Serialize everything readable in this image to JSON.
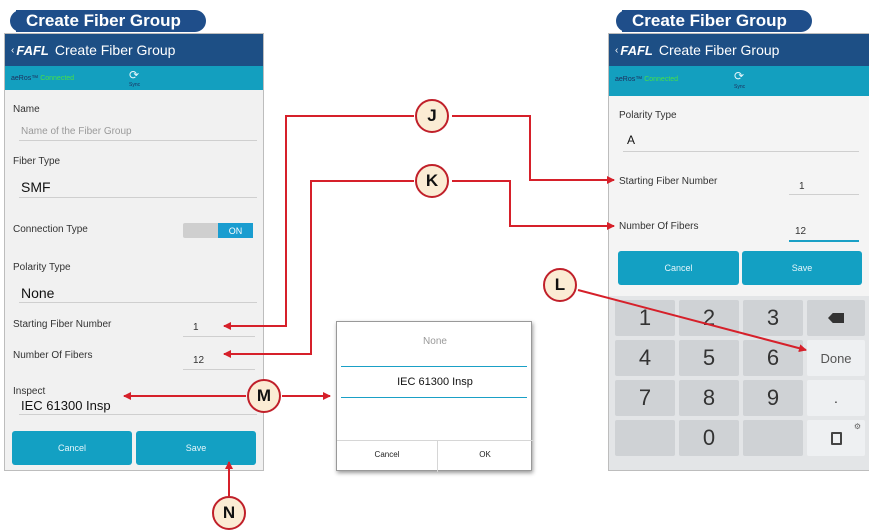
{
  "left_title": "Create Fiber Group",
  "right_title": "Create Fiber Group",
  "app": {
    "logo": "FAFL",
    "title": "Create Fiber Group",
    "aeros": "aeRos™",
    "connected": "Connected",
    "sync": "Sync"
  },
  "left_form": {
    "name_label": "Name",
    "name_placeholder": "Name of the Fiber Group",
    "fiber_type_label": "Fiber Type",
    "fiber_type_value": "SMF",
    "connection_type_label": "Connection Type",
    "toggle_on": "ON",
    "polarity_label": "Polarity Type",
    "polarity_value": "None",
    "starting_fiber_label": "Starting Fiber Number",
    "starting_fiber_value": "1",
    "num_fibers_label": "Number Of Fibers",
    "num_fibers_value": "12",
    "inspect_label": "Inspect",
    "inspect_value": "IEC 61300 Insp",
    "cancel": "Cancel",
    "save": "Save"
  },
  "dialog": {
    "option_none": "None",
    "option_selected": "IEC 61300 Insp",
    "cancel": "Cancel",
    "ok": "OK"
  },
  "right_form": {
    "polarity_label": "Polarity Type",
    "polarity_value": "A",
    "starting_fiber_label": "Starting Fiber Number",
    "starting_fiber_value": "1",
    "num_fibers_label": "Number Of Fibers",
    "num_fibers_value": "12",
    "cancel": "Cancel",
    "save": "Save"
  },
  "keypad": {
    "k1": "1",
    "k2": "2",
    "k3": "3",
    "k4": "4",
    "k5": "5",
    "k6": "6",
    "k7": "7",
    "k8": "8",
    "k9": "9",
    "k0": "0",
    "dot": ".",
    "done": "Done"
  },
  "callouts": {
    "J": "J",
    "K": "K",
    "L": "L",
    "M": "M",
    "N": "N"
  },
  "colors": {
    "appbar": "#1d4f85",
    "statusbar": "#139fbf",
    "button": "#13a0c3",
    "arrow": "#d6202a",
    "badge_fill": "#fbecd4"
  }
}
